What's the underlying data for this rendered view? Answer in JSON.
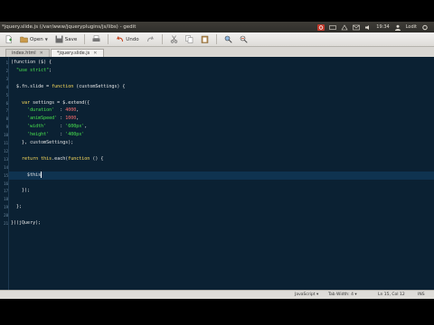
{
  "window": {
    "title": "*jquery.slide.js (/var/www/jqueryplugins/js/libs) - gedit"
  },
  "system_tray": {
    "time": "19:34",
    "user": "Lodit"
  },
  "toolbar": {
    "open_label": "Open",
    "save_label": "Save",
    "undo_label": "Undo"
  },
  "tabs": [
    {
      "label": "index.html"
    },
    {
      "label": "*jquery.slide.js"
    }
  ],
  "editor": {
    "current_line": 15,
    "lines": [
      {
        "n": "1",
        "segments": [
          [
            "plain",
            "(function ($) {"
          ]
        ]
      },
      {
        "n": "2",
        "segments": [
          [
            "plain",
            "  "
          ],
          [
            "str",
            "\"use strict\""
          ],
          [
            "plain",
            ";"
          ]
        ]
      },
      {
        "n": "3",
        "segments": []
      },
      {
        "n": "4",
        "segments": [
          [
            "plain",
            "  $.fn.slide = "
          ],
          [
            "kw",
            "function"
          ],
          [
            "plain",
            " (customSettings) {"
          ]
        ]
      },
      {
        "n": "5",
        "segments": []
      },
      {
        "n": "6",
        "segments": [
          [
            "plain",
            "    "
          ],
          [
            "kw",
            "var"
          ],
          [
            "plain",
            " settings = $.extend({"
          ]
        ]
      },
      {
        "n": "7",
        "segments": [
          [
            "plain",
            "      "
          ],
          [
            "str",
            "'duration'"
          ],
          [
            "plain",
            "  : "
          ],
          [
            "num",
            "4000"
          ],
          [
            "plain",
            ","
          ]
        ]
      },
      {
        "n": "8",
        "segments": [
          [
            "plain",
            "      "
          ],
          [
            "str",
            "'animSpeed'"
          ],
          [
            "plain",
            " : "
          ],
          [
            "num",
            "1000"
          ],
          [
            "plain",
            ","
          ]
        ]
      },
      {
        "n": "9",
        "segments": [
          [
            "plain",
            "      "
          ],
          [
            "str",
            "'width'"
          ],
          [
            "plain",
            "     : "
          ],
          [
            "str",
            "'600px'"
          ],
          [
            "plain",
            ","
          ]
        ]
      },
      {
        "n": "10",
        "segments": [
          [
            "plain",
            "      "
          ],
          [
            "str",
            "'height'"
          ],
          [
            "plain",
            "    : "
          ],
          [
            "str",
            "'400px'"
          ]
        ]
      },
      {
        "n": "11",
        "segments": [
          [
            "plain",
            "    }, customSettings);"
          ]
        ]
      },
      {
        "n": "12",
        "segments": []
      },
      {
        "n": "13",
        "segments": [
          [
            "plain",
            "    "
          ],
          [
            "kw",
            "return"
          ],
          [
            "plain",
            " "
          ],
          [
            "kw",
            "this"
          ],
          [
            "plain",
            ".each("
          ],
          [
            "kw",
            "function"
          ],
          [
            "plain",
            " () {"
          ]
        ]
      },
      {
        "n": "14",
        "segments": []
      },
      {
        "n": "15",
        "segments": [
          [
            "plain",
            "      $this"
          ]
        ],
        "caret": true
      },
      {
        "n": "16",
        "segments": []
      },
      {
        "n": "17",
        "segments": [
          [
            "plain",
            "    });"
          ]
        ]
      },
      {
        "n": "18",
        "segments": []
      },
      {
        "n": "19",
        "segments": [
          [
            "plain",
            "  };"
          ]
        ]
      },
      {
        "n": "20",
        "segments": []
      },
      {
        "n": "21",
        "segments": [
          [
            "plain",
            "})(jQuery);"
          ]
        ]
      }
    ]
  },
  "statusbar": {
    "language": "JavaScript",
    "tab_width": "Tab Width: 4",
    "position": "Ln 15, Col 12",
    "mode": "INS"
  }
}
